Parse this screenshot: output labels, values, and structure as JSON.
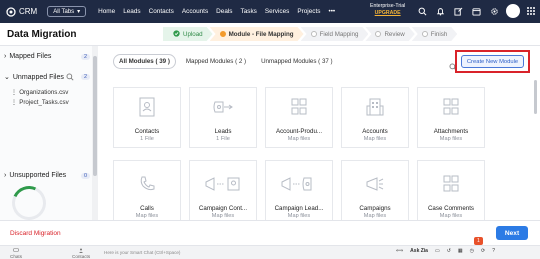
{
  "topbar": {
    "brand": "CRM",
    "all_tabs": "All Tabs",
    "nav": [
      "Home",
      "Leads",
      "Contacts",
      "Accounts",
      "Deals",
      "Tasks",
      "Services",
      "Projects",
      "•••"
    ],
    "trial_label": "Enterprise-Trial",
    "upgrade": "UPGRADE",
    "icons": [
      "search-icon",
      "bell-icon",
      "edit-icon",
      "calendar-icon",
      "gear-icon",
      "settings-icon"
    ]
  },
  "header": {
    "title": "Data Migration",
    "steps": [
      {
        "label": "Upload",
        "state": "done"
      },
      {
        "label": "Module - File Mapping",
        "state": "active"
      },
      {
        "label": "Field Mapping",
        "state": "pending"
      },
      {
        "label": "Review",
        "state": "pending"
      },
      {
        "label": "Finish",
        "state": "pending"
      }
    ]
  },
  "sidebar": {
    "mapped": {
      "label": "Mapped Files",
      "count": "2"
    },
    "unmapped": {
      "label": "Unmapped Files",
      "count": "2",
      "files": [
        "Organizations.csv",
        "Project_Tasks.csv"
      ]
    },
    "unsupported": {
      "label": "Unsupported Files",
      "count": "0"
    }
  },
  "main": {
    "filters": [
      "All Modules ( 39 )",
      "Mapped Modules ( 2 )",
      "Unmapped Modules ( 37 )"
    ],
    "create_button": "Create New Module",
    "cards": [
      {
        "name": "Contacts",
        "status": "1 File",
        "icon": "contacts-icon"
      },
      {
        "name": "Leads",
        "status": "1 File",
        "icon": "leads-icon"
      },
      {
        "name": "Account-Produ...",
        "status": "Map files",
        "icon": "account-products-icon"
      },
      {
        "name": "Accounts",
        "status": "Map files",
        "icon": "accounts-icon"
      },
      {
        "name": "Attachments",
        "status": "Map files",
        "icon": "attachments-icon"
      },
      {
        "name": "Calls",
        "status": "Map files",
        "icon": "phone-icon"
      },
      {
        "name": "Campaign Cont...",
        "status": "Map files",
        "icon": "campaign-contacts-icon"
      },
      {
        "name": "Campaign Lead...",
        "status": "Map files",
        "icon": "campaign-leads-icon"
      },
      {
        "name": "Campaigns",
        "status": "Map files",
        "icon": "megaphone-icon"
      },
      {
        "name": "Case Comments",
        "status": "Map files",
        "icon": "case-comments-icon"
      }
    ]
  },
  "footer": {
    "discard": "Discard Migration",
    "next": "Next"
  },
  "bottombar": {
    "chat_placeholder": "Here is your Smart Chat (Ctrl+Space)",
    "left_items": [
      "Chats",
      "Contacts"
    ],
    "ask_zia": "Ask Zia",
    "notification_count": "1"
  }
}
